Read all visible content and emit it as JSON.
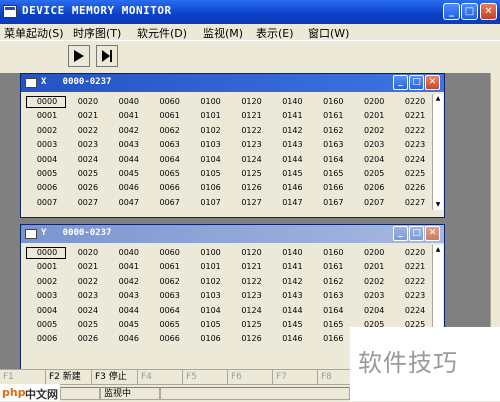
{
  "window": {
    "title": "DEVICE MEMORY MONITOR",
    "min": "_",
    "max": "□",
    "close": "✕"
  },
  "menu": [
    "菜单起动(S)",
    "时序图(T)",
    "软元件(D)",
    "监视(M)",
    "表示(E)",
    "窗口(W)"
  ],
  "toolbar": {
    "buttons": [
      "play-icon",
      "step-icon"
    ]
  },
  "x_window": {
    "title": "X   0000-0237",
    "rows": [
      [
        "0000",
        "0020",
        "0040",
        "0060",
        "0100",
        "0120",
        "0140",
        "0160",
        "0200",
        "0220"
      ],
      [
        "0001",
        "0021",
        "0041",
        "0061",
        "0101",
        "0121",
        "0141",
        "0161",
        "0201",
        "0221"
      ],
      [
        "0002",
        "0022",
        "0042",
        "0062",
        "0102",
        "0122",
        "0142",
        "0162",
        "0202",
        "0222"
      ],
      [
        "0003",
        "0023",
        "0043",
        "0063",
        "0103",
        "0123",
        "0143",
        "0163",
        "0203",
        "0223"
      ],
      [
        "0004",
        "0024",
        "0044",
        "0064",
        "0104",
        "0124",
        "0144",
        "0164",
        "0204",
        "0224"
      ],
      [
        "0005",
        "0025",
        "0045",
        "0065",
        "0105",
        "0125",
        "0145",
        "0165",
        "0205",
        "0225"
      ],
      [
        "0006",
        "0026",
        "0046",
        "0066",
        "0106",
        "0126",
        "0146",
        "0166",
        "0206",
        "0226"
      ],
      [
        "0007",
        "0027",
        "0047",
        "0067",
        "0107",
        "0127",
        "0147",
        "0167",
        "0207",
        "0227"
      ]
    ]
  },
  "y_window": {
    "title": "Y   0000-0237",
    "rows": [
      [
        "0000",
        "0020",
        "0040",
        "0060",
        "0100",
        "0120",
        "0140",
        "0160",
        "0200",
        "0220"
      ],
      [
        "0001",
        "0021",
        "0041",
        "0061",
        "0101",
        "0121",
        "0141",
        "0161",
        "0201",
        "0221"
      ],
      [
        "0002",
        "0022",
        "0042",
        "0062",
        "0102",
        "0122",
        "0142",
        "0162",
        "0202",
        "0222"
      ],
      [
        "0003",
        "0023",
        "0043",
        "0063",
        "0103",
        "0123",
        "0143",
        "0163",
        "0203",
        "0223"
      ],
      [
        "0004",
        "0024",
        "0044",
        "0064",
        "0104",
        "0124",
        "0144",
        "0164",
        "0204",
        "0224"
      ],
      [
        "0005",
        "0025",
        "0045",
        "0065",
        "0105",
        "0125",
        "0145",
        "0165",
        "0205",
        "0225"
      ],
      [
        "0006",
        "0026",
        "0046",
        "0066",
        "0106",
        "0126",
        "0146",
        "0166",
        "",
        ""
      ]
    ]
  },
  "fkeys": [
    {
      "label": "F1",
      "active": false
    },
    {
      "label": "F2 新建",
      "active": true
    },
    {
      "label": "F3 停止",
      "active": true
    },
    {
      "label": "F4",
      "active": false
    },
    {
      "label": "F5",
      "active": false
    },
    {
      "label": "F6",
      "active": false
    },
    {
      "label": "F7",
      "active": false
    },
    {
      "label": "F8",
      "active": false
    }
  ],
  "status": {
    "state": "监视中"
  },
  "logo": "中文网",
  "watermark": "软件技巧"
}
